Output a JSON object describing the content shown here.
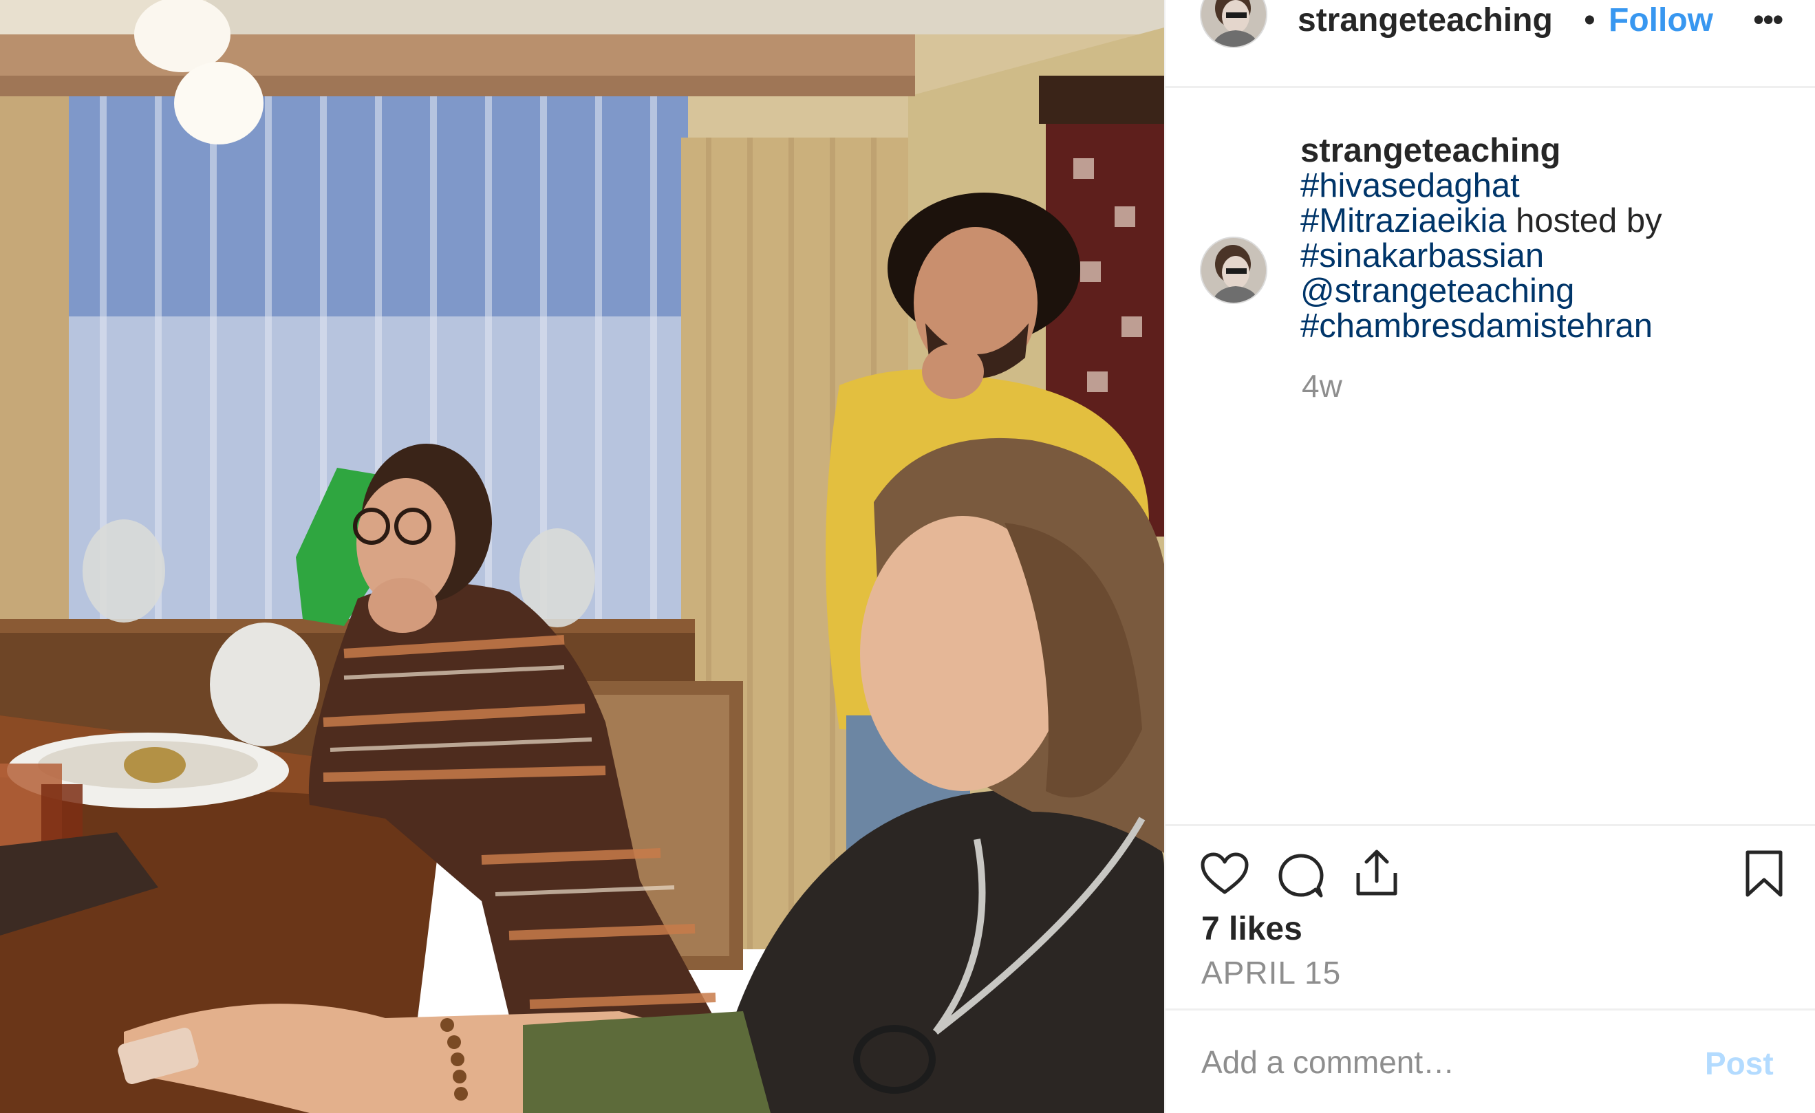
{
  "post": {
    "username": "strangeteaching",
    "separator": "•",
    "follow_label": "Follow",
    "more_icon": "ellipsis-icon",
    "more_label": "•••"
  },
  "caption": {
    "username": "strangeteaching",
    "tag1": "#hivasedaghat",
    "tag2": "#Mitraziaeikia",
    "text1": " hosted by",
    "tag3": "#sinakarbassian",
    "mention": "@strangeteaching",
    "tag4": "#chambresdamistehran",
    "time": "4w"
  },
  "actions": {
    "like_icon": "heart-icon",
    "comment_icon": "comment-icon",
    "share_icon": "share-icon",
    "save_icon": "bookmark-icon",
    "likes": "7 likes",
    "date": "APRIL 15"
  },
  "comment": {
    "placeholder": "Add a comment…",
    "post_label": "Post"
  },
  "colors": {
    "link": "#003569",
    "follow": "#3897f0",
    "post_disabled": "#b3dbff",
    "muted": "#8e8e8e"
  }
}
